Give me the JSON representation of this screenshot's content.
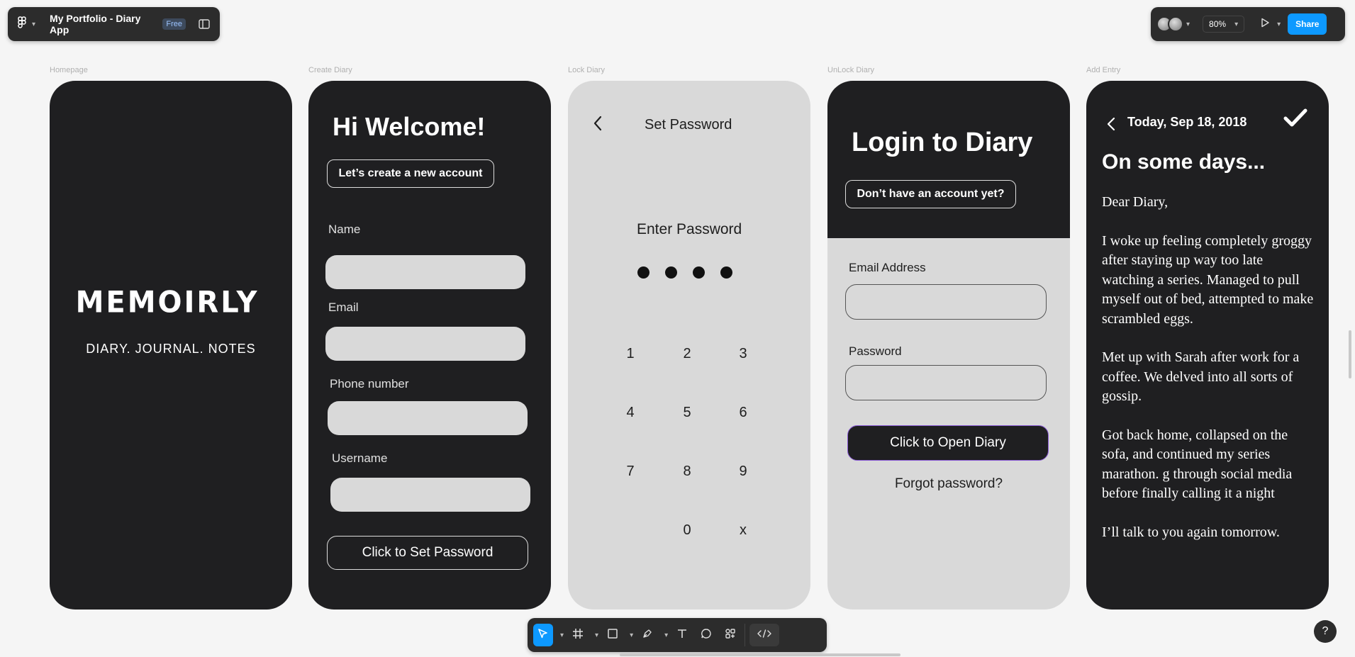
{
  "header": {
    "file_title": "My Portfolio - Diary App",
    "plan_badge": "Free",
    "zoom": "80%",
    "share_label": "Share"
  },
  "frames": {
    "labels": [
      "Homepage",
      "Create Diary",
      "Lock Diary",
      "UnLock Diary",
      "Add Entry"
    ]
  },
  "homepage": {
    "logo": "MEMOIRLY",
    "tagline": "DIARY. JOURNAL. NOTES"
  },
  "create": {
    "title": "Hi Welcome!",
    "subtitle": "Let’s create a new account",
    "name_label": "Name",
    "email_label": "Email",
    "phone_label": "Phone number",
    "username_label": "Username",
    "button": "Click to Set Password"
  },
  "lock": {
    "title": "Set Password",
    "prompt": "Enter Password",
    "keys": [
      "1",
      "2",
      "3",
      "4",
      "5",
      "6",
      "7",
      "8",
      "9",
      "0",
      "x"
    ]
  },
  "unlock": {
    "title": "Login to Diary",
    "no_account": "Don’t have an account yet?",
    "email_label": "Email Address",
    "password_label": "Password",
    "button": "Click to Open Diary",
    "forgot": "Forgot password?"
  },
  "entry": {
    "date": "Today, Sep 18, 2018",
    "title": "On some days...",
    "paragraphs": [
      "Dear Diary,",
      "I woke up feeling completely groggy after staying up way too late watching a series. Managed to pull myself out of bed, attempted to make scrambled eggs.",
      "Met up with Sarah after work for a coffee. We delved into all sorts of gossip.",
      "Got back home, collapsed on the sofa, and continued my series marathon. g through social media before finally calling it a night",
      "I’ll talk to you again tomorrow."
    ]
  },
  "help": "?",
  "colors": {
    "accent": "#0d99ff",
    "frame_dark": "#1f1f21",
    "frame_light": "#d9d9d9",
    "open_button_border": "#8a5bd6"
  }
}
